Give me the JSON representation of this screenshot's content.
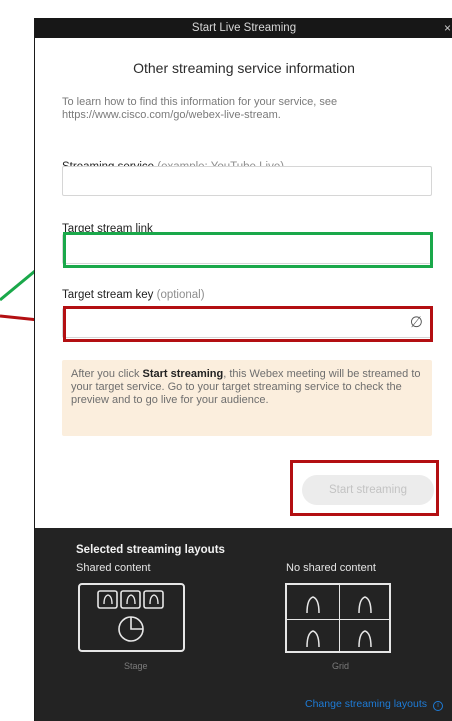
{
  "window": {
    "title": "Start Live Streaming",
    "close_glyph": "×"
  },
  "dialog": {
    "subtitle": "Other streaming service information",
    "description": "To learn how to find this information for your service, see https://www.cisco.com/go/webex-live-stream.",
    "streaming_service": {
      "label": "Streaming service",
      "hint": "(example: YouTube Live)",
      "value": "",
      "placeholder": ""
    },
    "target_link": {
      "label": "Target stream link",
      "value": "",
      "placeholder": ""
    },
    "target_key": {
      "label": "Target stream key",
      "hint": "(optional)",
      "value": "",
      "placeholder": "",
      "visibility_icon": "eye-off-icon",
      "visibility_glyph": "∅"
    },
    "notice": {
      "before": "After you click ",
      "bold": "Start streaming",
      "after": ", this Webex meeting will be streamed to your target service. Go to your target streaming service to check the preview and to go live for your audience."
    },
    "start_button": "Start streaming"
  },
  "layouts": {
    "title": "Selected streaming layouts",
    "shared_label": "Shared content",
    "no_shared_label": "No shared content",
    "stage_caption": "Stage",
    "grid_caption": "Grid",
    "change_link": "Change streaming layouts",
    "info_glyph": "i"
  },
  "colors": {
    "annotation_green": "#1aa84a",
    "annotation_red": "#b30f12",
    "link_blue": "#1e7bd6",
    "notice_bg": "#fbeedd",
    "dark_panel": "#232323"
  }
}
